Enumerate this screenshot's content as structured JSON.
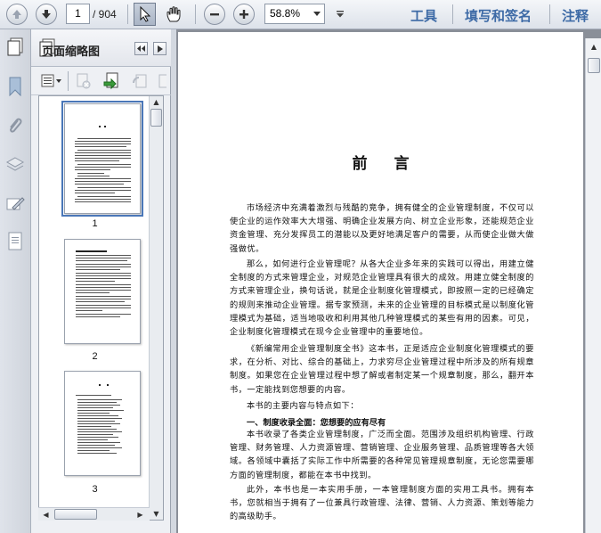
{
  "toolbar": {
    "current_page": "1",
    "page_count": "/ 904",
    "zoom": "58.8%",
    "tools_label": "工具",
    "sign_label": "填写和签名",
    "comment_label": "注释"
  },
  "panel": {
    "title": "页面缩略图",
    "thumbnails": [
      {
        "number": "1"
      },
      {
        "number": "2"
      },
      {
        "number": "3"
      }
    ]
  },
  "document": {
    "title": "前 言",
    "paragraphs": [
      "市场经济中充满着激烈与残酷的竞争，拥有健全的企业管理制度，不仅可以使企业的运作效率大大增强、明确企业发展方向、树立企业形象，还能规范企业资金管理、充分发挥员工的潜能以及更好地满足客户的需要，从而使企业做大做强做优。",
      "那么，如何进行企业管理呢？从各大企业多年来的实践可以得出，用建立健全制度的方式来管理企业，对规范企业管理具有很大的成效。用建立健全制度的方式来管理企业，换句话说，就是企业制度化管理模式，即按照一定的已经确定的规则来推动企业管理。据专家预测，未来的企业管理的目标模式是以制度化管理模式为基础，适当地吸收和利用其他几种管理模式的某些有用的因素。可见，企业制度化管理模式在现今企业管理中的重要地位。",
      "《新编常用企业管理制度全书》这本书，正是适应企业制度化管理模式的要求，在分析、对比、综合的基础上，力求穷尽企业管理过程中所涉及的所有规章制度。如果您在企业管理过程中想了解或者制定某一个规章制度，那么，翻开本书，一定能找到您想要的内容。",
      "本书的主要内容与特点如下：",
      "一、制度收录全面：您想要的应有尽有",
      "本书收录了各类企业管理制度，广泛而全面。范围涉及组织机构管理、行政管理、财务管理、人力资源管理、营销管理、企业服务管理、品质管理等各大领域。各领域中囊括了实际工作中所需要的各种常见管理规章制度，无论您需要哪方面的管理制度，都能在本书中找到。",
      "此外，本书也是一本实用手册，一本管理制度方面的实用工具书。拥有本书，您就相当于拥有了一位兼具行政管理、法律、营销、人力资源、策划等能力的高级助手。"
    ]
  },
  "colors": {
    "link": "#3d6aa6",
    "doc_background": "#8a8f98",
    "selection": "#4a77b8"
  }
}
